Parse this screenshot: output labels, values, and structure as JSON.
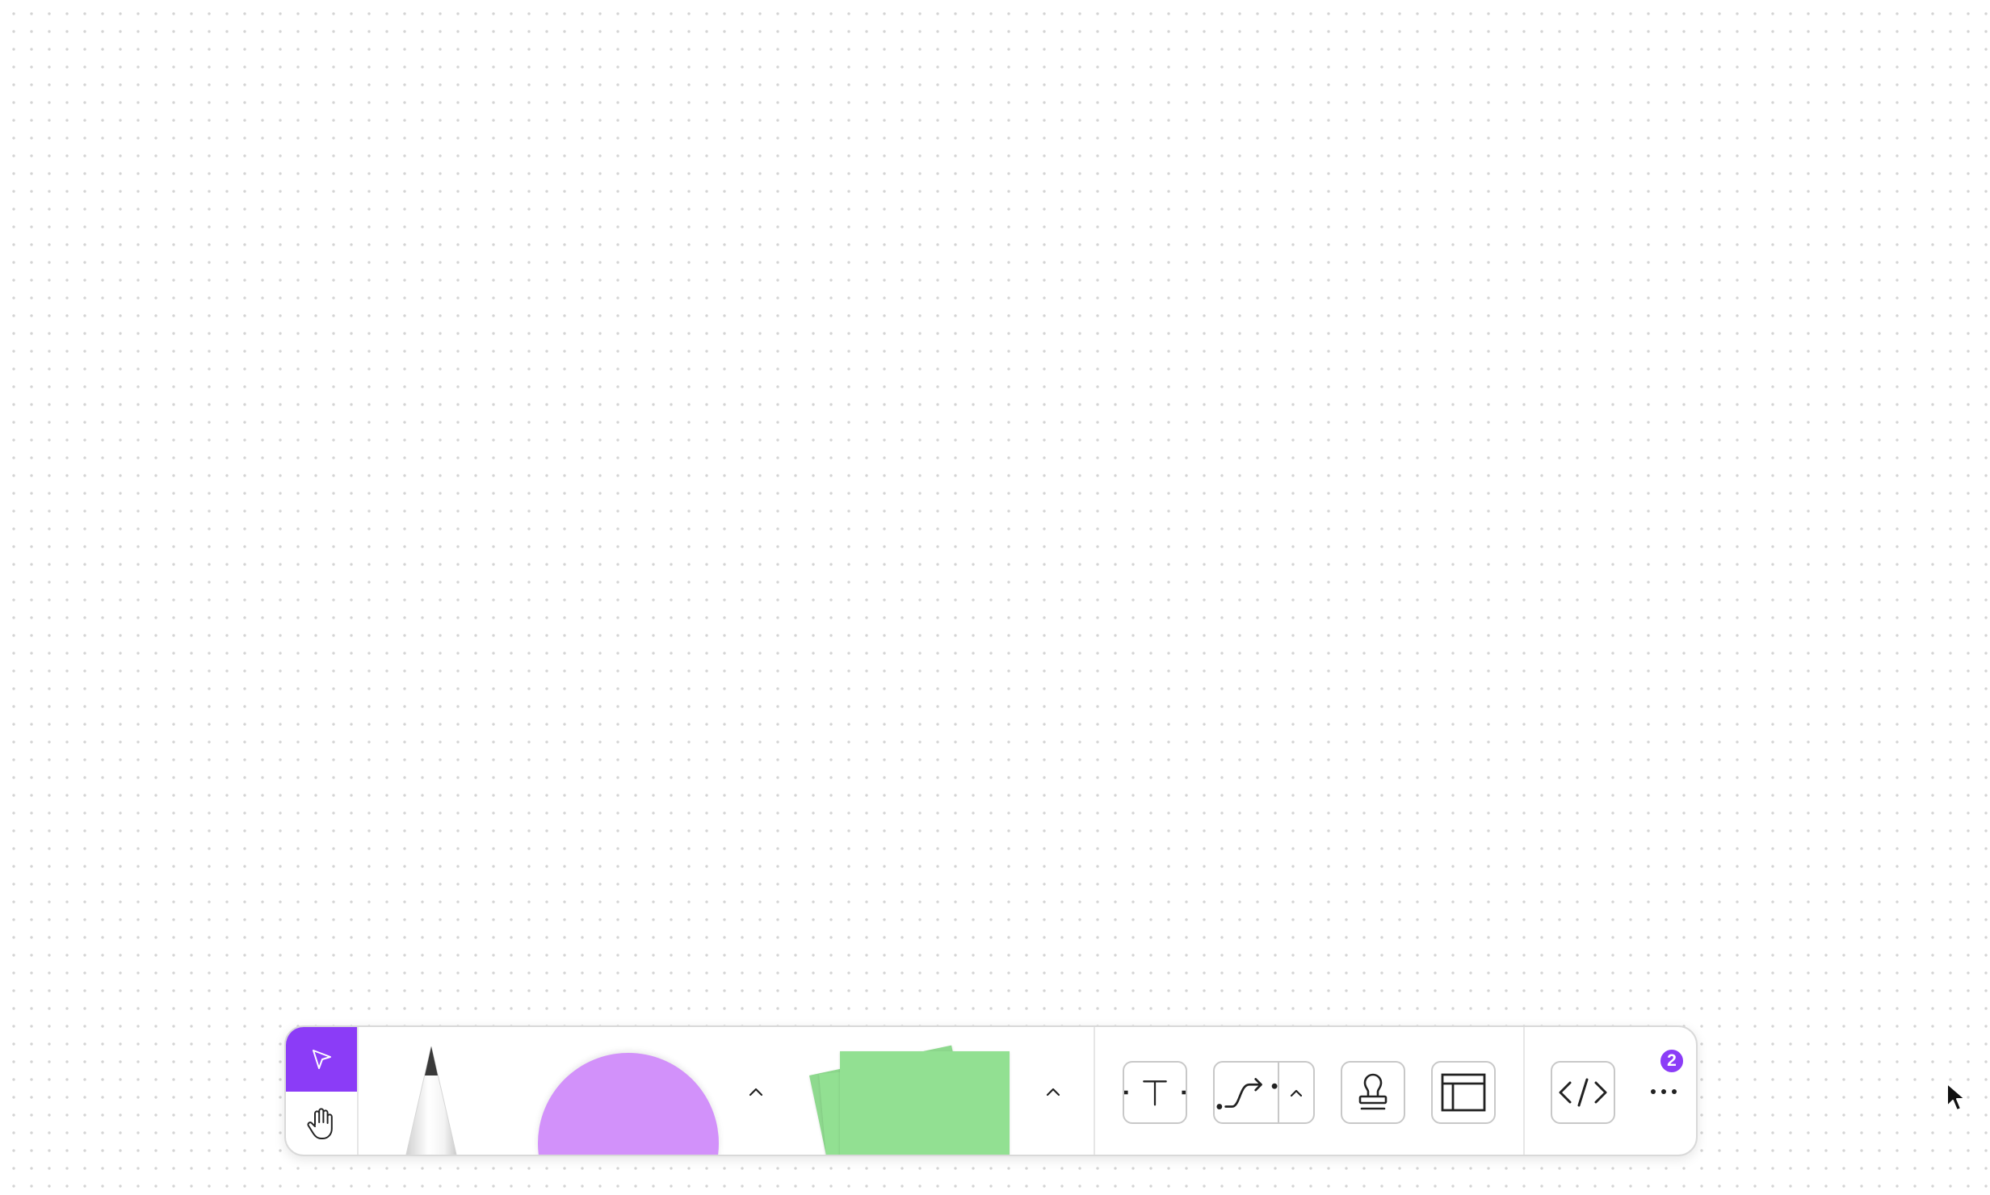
{
  "colors": {
    "accent": "#8b3cf7",
    "circle_shape": "#d291fa",
    "sticky_note": "#92e092",
    "icon_stroke": "#222222"
  },
  "toolbar": {
    "modes": [
      {
        "icon": "pointer-arrow-icon",
        "active": true
      },
      {
        "icon": "hand-icon",
        "active": false
      }
    ],
    "tools": [
      {
        "icon": "pencil-icon"
      },
      {
        "icon": "circle-shape-icon"
      },
      {
        "icon": "chevron-up-icon"
      },
      {
        "icon": "sticky-note-icon"
      },
      {
        "icon": "chevron-up-icon"
      },
      {
        "icon": "text-tool-icon"
      },
      {
        "icon": "connector-icon"
      },
      {
        "icon": "chevron-up-icon"
      },
      {
        "icon": "stamp-icon"
      },
      {
        "icon": "section-icon"
      },
      {
        "icon": "code-icon"
      },
      {
        "icon": "more-dots-icon"
      }
    ],
    "more_badge_count": "2"
  }
}
